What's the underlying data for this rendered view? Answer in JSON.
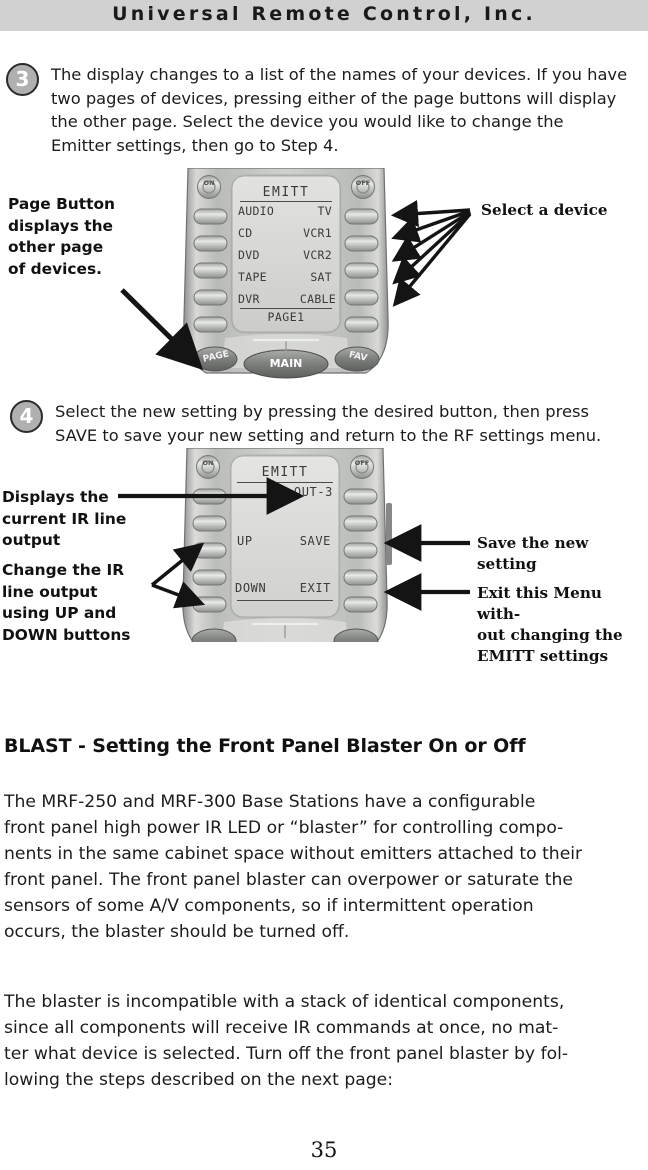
{
  "header": {
    "title": "Universal Remote Control, Inc."
  },
  "steps": [
    {
      "number": "3",
      "lines": [
        "The display changes to a list of the names of your devices. If you have",
        "two pages of devices, pressing either of the page buttons will display",
        "the other page. Select the device you would like to change the",
        "Emitter settings, then go to Step 4."
      ]
    },
    {
      "number": "4",
      "lines": [
        "Select the new setting by pressing the desired button, then press",
        "SAVE to save your new setting and return to the RF settings menu."
      ]
    }
  ],
  "figure1": {
    "callout_left": [
      "Page Button",
      "displays the",
      "other page",
      "of devices."
    ],
    "callout_right": "Select a device",
    "lcd": {
      "title": "EMITT",
      "rows": [
        [
          "AUDIO",
          "TV"
        ],
        [
          "CD",
          "VCR1"
        ],
        [
          "DVD",
          "VCR2"
        ],
        [
          "TAPE",
          "SAT"
        ],
        [
          "DVR",
          "CABLE"
        ]
      ],
      "footer": "PAGE1"
    },
    "buttons": {
      "power_on": "ON",
      "power_off": "OFF",
      "page": "PAGE",
      "main": "MAIN",
      "fav": "FAV"
    }
  },
  "figure2": {
    "callout_left_1": [
      "Displays the",
      "current IR line",
      "output"
    ],
    "callout_left_2": [
      "Change the IR",
      "line output",
      "using UP and",
      "DOWN buttons"
    ],
    "callout_right_1": "Save the new setting",
    "callout_right_2": [
      "Exit this Menu with-",
      "out changing the",
      "EMITT settings"
    ],
    "lcd": {
      "title": "EMITT",
      "value": "OUT-3",
      "row_mid": [
        "UP",
        "SAVE"
      ],
      "row_bottom": [
        "DOWN",
        "EXIT"
      ]
    },
    "buttons": {
      "power_on": "ON",
      "power_off": "OFF"
    }
  },
  "section": {
    "heading": "BLAST - Setting the Front Panel Blaster On or Off",
    "paragraph1": [
      "The MRF-250 and MRF-300 Base Stations have a configurable",
      "front panel high power IR LED or “blaster” for controlling compo-",
      "nents in the same cabinet space without emitters attached to their",
      "front panel. The front panel blaster can overpower or saturate the",
      "sensors of some A/V components, so if intermittent operation",
      "occurs, the blaster should be turned off."
    ],
    "paragraph2": [
      "The blaster is incompatible with a stack of identical components,",
      "since all components will receive IR commands at once, no mat-",
      "ter what device is selected. Turn off the front panel blaster by fol-",
      "lowing the steps described on the next page:"
    ]
  },
  "footer": {
    "page_number": "35"
  },
  "colors": {
    "header_band": "#d1d1d1",
    "badge_fill": "#b0b0b0",
    "lcd_fill": "#d5d6d2",
    "remote_body": "#c9cbc9",
    "text": "#1c1c1c"
  }
}
